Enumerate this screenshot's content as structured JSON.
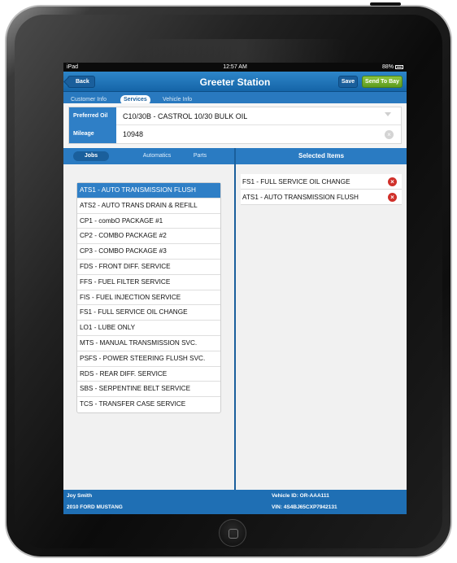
{
  "status_bar": {
    "carrier": "iPad",
    "time": "12:57 AM",
    "battery": "88%"
  },
  "nav": {
    "back_label": "Back",
    "title": "Greeter Station",
    "save_label": "Save",
    "send_label": "Send To Bay"
  },
  "top_tabs": [
    "Customer Info",
    "Services",
    "Vehicle Info"
  ],
  "form": {
    "preferred_oil_label": "Preferred Oil",
    "preferred_oil_value": "C10/30B - CASTROL 10/30 BULK OIL",
    "mileage_label": "Mileage",
    "mileage_value": "10948"
  },
  "left_tabs": [
    "Jobs",
    "Automatics",
    "Parts"
  ],
  "right_header": "Selected Items",
  "jobs": [
    "ATS1 - AUTO TRANSMISSION FLUSH",
    "ATS2 - AUTO TRANS DRAIN & REFILL",
    "CP1 - combO PACKAGE #1",
    "CP2 - COMBO PACKAGE #2",
    "CP3 - COMBO PACKAGE #3",
    "FDS - FRONT DIFF. SERVICE",
    "FFS - FUEL FILTER SERVICE",
    "FIS - FUEL INJECTION SERVICE",
    "FS1 - FULL SERVICE OIL CHANGE",
    "LO1 - LUBE ONLY",
    "MTS - MANUAL TRANSMISSION SVC.",
    "PSFS - POWER STEERING FLUSH SVC.",
    "RDS - REAR DIFF. SERVICE",
    "SBS - SERPENTINE BELT SERVICE",
    "TCS - TRANSFER CASE SERVICE"
  ],
  "selected_items": [
    "FS1 - FULL SERVICE OIL CHANGE",
    "ATS1 - AUTO TRANSMISSION FLUSH"
  ],
  "footer": {
    "customer_name": "Joy Smith",
    "vehicle": "2010 FORD MUSTANG",
    "vehicle_id": "Vehicle ID: OR-AAA111",
    "vin": "VIN: 4S4BJ65CXP7942131"
  }
}
